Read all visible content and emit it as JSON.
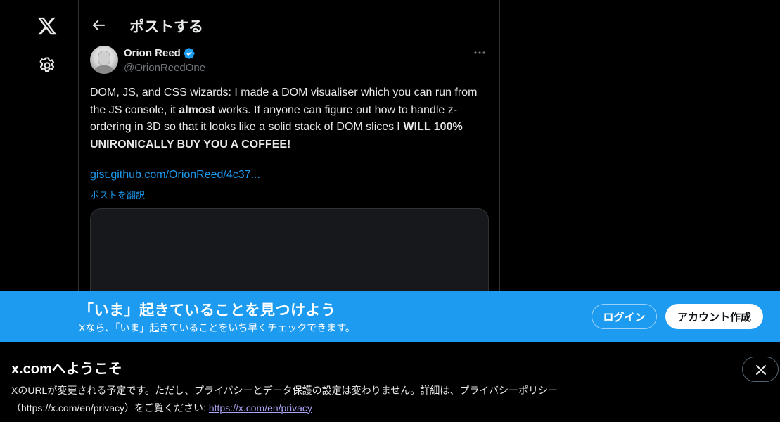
{
  "nav": {
    "logo_icon": "x-logo-icon",
    "settings_icon": "gear-icon"
  },
  "header": {
    "back_icon": "arrow-left-icon",
    "title": "ポストする"
  },
  "tweet": {
    "author_name": "Orion Reed",
    "verified_icon": "verified-badge-icon",
    "author_handle": "@OrionReedOne",
    "more_icon": "more-horizontal-icon",
    "text_part1": "DOM, JS, and CSS wizards: I made a DOM visualiser which you can run from the JS console, it ",
    "text_bold1": "almost",
    "text_part2": " works. If anyone can figure out how to handle z-ordering in 3D so that it looks like a solid stack of DOM slices ",
    "text_bold2": "I WILL 100% UNIRONICALLY BUY YOU A COFFEE!",
    "link": "gist.github.com/OrionReed/4c37...",
    "translate_label": "ポストを翻訳"
  },
  "banner": {
    "title": "「いま」起きていることを見つけよう",
    "subtitle": "Xなら、「いま」起きていることをいち早くチェックできます。",
    "login_label": "ログイン",
    "signup_label": "アカウント作成",
    "color": "#1d9bf0"
  },
  "notice": {
    "title": "x.comへようこそ",
    "body": "XのURLが変更される予定です。ただし、プライバシーとデータ保護の設定は変わりません。詳細は、プライバシーポリシー（https://x.com/en/privacy）をご覧ください: ",
    "link": "https://x.com/en/privacy",
    "close_icon": "close-icon"
  }
}
